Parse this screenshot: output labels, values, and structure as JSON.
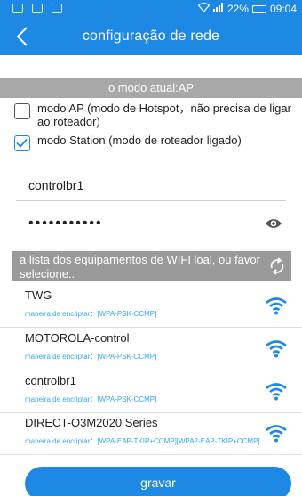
{
  "status": {
    "battery": "22%",
    "time": "09:04"
  },
  "header": {
    "title": "configuração de rede"
  },
  "mode": {
    "current": "o modo atual:AP"
  },
  "options": [
    {
      "label": "modo AP (modo de Hotspot，não precisa de ligar ao roteador)",
      "checked": false
    },
    {
      "label": "modo Station (modo de roteador ligado)",
      "checked": true
    }
  ],
  "ssid": {
    "value": "controlbr1"
  },
  "password": {
    "value": "•••••••••••"
  },
  "wifi_list": {
    "header": "a lista dos equipamentos de WIFI loal, ou favor selecione..",
    "items": [
      {
        "name": "TWG",
        "encryption": "maneira de encriptar：[WPA-PSK-CCMP]"
      },
      {
        "name": "MOTOROLA-control",
        "encryption": "maneira de encriptar：[WPA-PSK-CCMP]"
      },
      {
        "name": "controlbr1",
        "encryption": "maneira de encriptar：[WPA-PSK-CCMP]"
      },
      {
        "name": "DIRECT-O3M2020 Series",
        "encryption": "maneira de encriptar：[WPA-EAP-TKIP+CCMP][WPA2-EAP-TKIP+CCMP]"
      }
    ]
  },
  "actions": {
    "save": "gravar"
  },
  "colors": {
    "accent": "#1e88e5",
    "mode_bar": "#a8a8a8",
    "wifi_header": "#9a9a9a",
    "encryption_text": "#34a9e8"
  }
}
